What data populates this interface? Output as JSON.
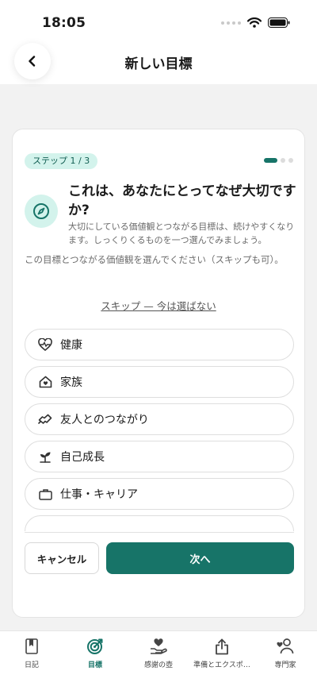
{
  "status_bar": {
    "time": "18:05"
  },
  "header": {
    "title": "新しい目標"
  },
  "card": {
    "step_label": "ステップ 1 / 3",
    "progress": {
      "current": 1,
      "total": 3
    },
    "question": "これは、あなたにとってなぜ大切ですか?",
    "subtext": "大切にしている価値観とつながる目標は、続けやすくなります。しっくりくるものを一つ選んでみましょう。",
    "prompt": "この目標とつながる価値観を選んでください（スキップも可）。",
    "skip_label": "スキップ — 今は選ばない",
    "options": [
      {
        "label": "健康",
        "icon": "heart-pulse-icon"
      },
      {
        "label": "家族",
        "icon": "home-heart-icon"
      },
      {
        "label": "友人とのつながり",
        "icon": "handshake-icon"
      },
      {
        "label": "自己成長",
        "icon": "sprout-icon"
      },
      {
        "label": "仕事・キャリア",
        "icon": "briefcase-icon"
      }
    ],
    "cancel_label": "キャンセル",
    "next_label": "次へ"
  },
  "tab_bar": {
    "active_index": 1,
    "tabs": [
      {
        "label": "日記",
        "icon": "journal-icon"
      },
      {
        "label": "目標",
        "icon": "target-icon"
      },
      {
        "label": "感謝の壺",
        "icon": "gratitude-jar-icon"
      },
      {
        "label": "準備とエクスポ…",
        "icon": "share-export-icon"
      },
      {
        "label": "専門家",
        "icon": "experts-icon"
      }
    ]
  },
  "colors": {
    "accent": "#177468",
    "accent_light": "#d3f3ec",
    "background": "#f2f2f2"
  }
}
